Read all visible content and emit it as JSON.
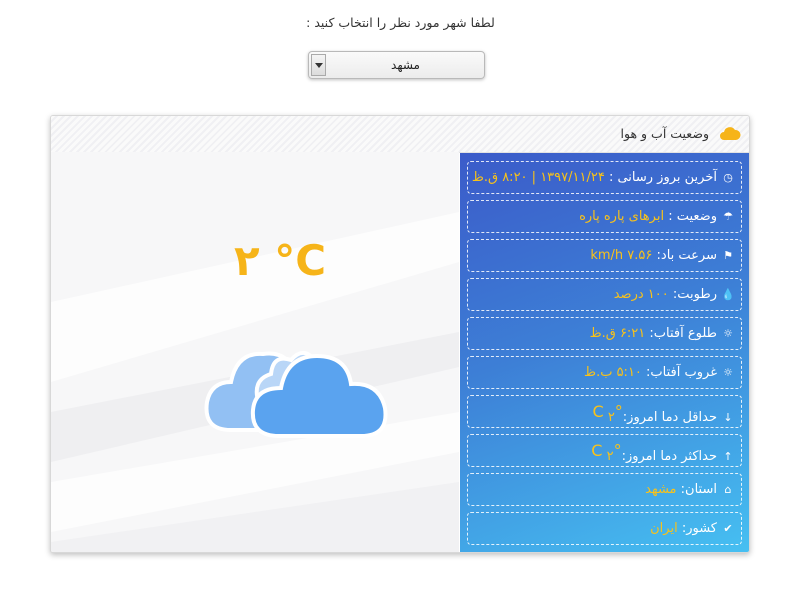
{
  "prompt": "لطفا شهر مورد نظر را انتخاب کنید :",
  "city_select": {
    "value": "مشهد"
  },
  "panel": {
    "title": "وضعیت آب و هوا",
    "temperature": "۲ °C"
  },
  "info": [
    {
      "icon": "clock-icon",
      "glyph": "◷",
      "label": "آخرین بروز رسانی :",
      "value": "۱۳۹۷/۱۱/۲۴ | ۸:۲۰ ق.ظ"
    },
    {
      "icon": "umbrella-icon",
      "glyph": "☂",
      "label": "وضعیت :",
      "value": "ابرهای پاره پاره"
    },
    {
      "icon": "flag-icon",
      "glyph": "⚑",
      "label": "سرعت باد:",
      "value": "۷.۵۶ km/h"
    },
    {
      "icon": "droplet-icon",
      "glyph": "💧",
      "label": "رطوبت:",
      "value": "۱۰۰ درصد"
    },
    {
      "icon": "sunrise-icon",
      "glyph": "☼",
      "label": "طلوع آفتاب:",
      "value": "۶:۲۱ ق.ظ"
    },
    {
      "icon": "sunset-icon",
      "glyph": "☼",
      "label": "غروب آفتاب:",
      "value": "۵:۱۰ ب.ظ"
    },
    {
      "icon": "arrow-down-icon",
      "glyph": "↓",
      "label": "حداقل دما امروز:",
      "value": "۲",
      "unit": "°C"
    },
    {
      "icon": "arrow-up-icon",
      "glyph": "↑",
      "label": "حداکثر دما امروز:",
      "value": "۲",
      "unit": "°C"
    },
    {
      "icon": "home-icon",
      "glyph": "⌂",
      "label": "استان:",
      "value": "مشهد"
    },
    {
      "icon": "check-circle-icon",
      "glyph": "✔",
      "label": "کشور:",
      "value": "ایران"
    }
  ],
  "colors": {
    "accent": "#f6b419",
    "box_top": "#3b5bc9",
    "box_bottom": "#46c0f2",
    "cloud": "#5aa3ef"
  }
}
